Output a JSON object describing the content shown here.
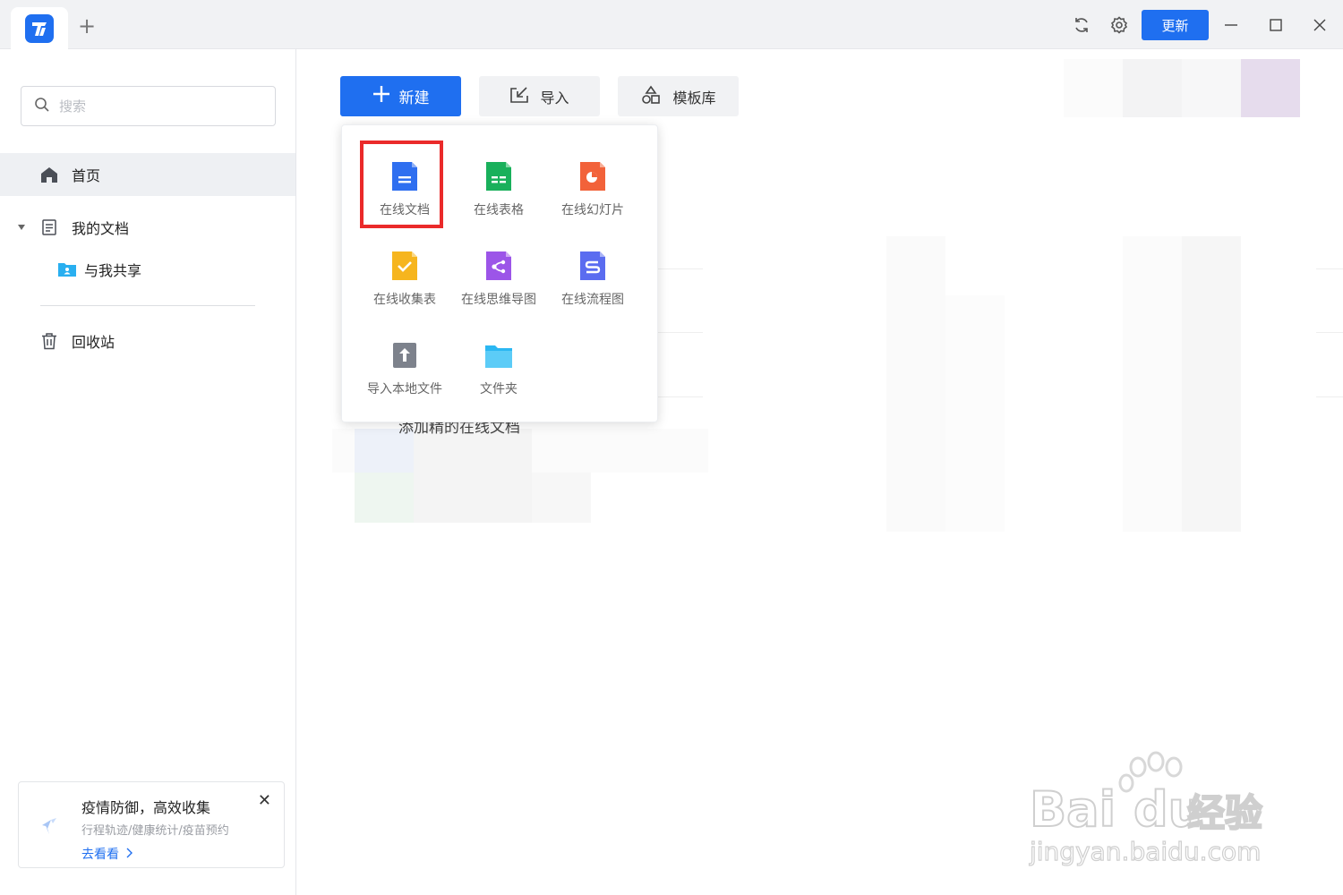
{
  "titlebar": {
    "update_label": "更新",
    "icons": [
      "sync-icon",
      "settings-icon",
      "minimize-icon",
      "maximize-icon",
      "close-icon"
    ]
  },
  "sidebar": {
    "search_placeholder": "搜索",
    "items": [
      {
        "label": "首页",
        "icon": "home-icon",
        "active": true
      },
      {
        "label": "我的文档",
        "icon": "document-icon"
      },
      {
        "label": "与我共享",
        "icon": "shared-folder-icon"
      },
      {
        "label": "回收站",
        "icon": "trash-icon"
      }
    ],
    "promo": {
      "title": "疫情防御，高效收集",
      "subtitle": "行程轨迹/健康统计/疫苗预约",
      "link": "去看看"
    }
  },
  "toolbar": {
    "new_label": "新建",
    "import_label": "导入",
    "templates_label": "模板库"
  },
  "new_menu": {
    "items": [
      {
        "label": "在线文档",
        "icon": "online-doc-icon",
        "color": "#2f6ff0"
      },
      {
        "label": "在线表格",
        "icon": "online-sheet-icon",
        "color": "#19b05b"
      },
      {
        "label": "在线幻灯片",
        "icon": "online-slides-icon",
        "color": "#f2623a"
      },
      {
        "label": "在线收集表",
        "icon": "online-form-icon",
        "color": "#f6b51e"
      },
      {
        "label": "在线思维导图",
        "icon": "mindmap-icon",
        "color": "#9c55e8"
      },
      {
        "label": "在线流程图",
        "icon": "flowchart-icon",
        "color": "#5a6cf0"
      },
      {
        "label": "导入本地文件",
        "icon": "upload-icon",
        "color": "#7d828c"
      },
      {
        "label": "文件夹",
        "icon": "folder-icon",
        "color": "#2bb7f2"
      }
    ]
  },
  "background_list": {
    "peek_row": "添加精的在线文档"
  },
  "watermark": {
    "brand": "Bai du 经验",
    "url": "jingyan.baidu.com"
  }
}
